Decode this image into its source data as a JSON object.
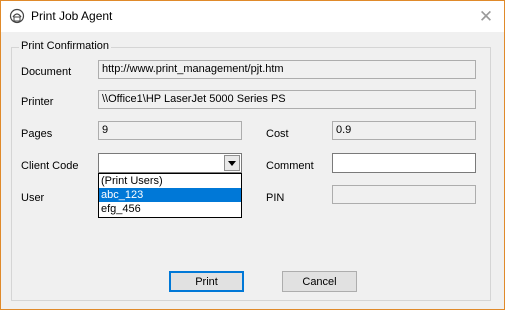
{
  "window": {
    "title": "Print Job Agent",
    "close_icon": "close-icon",
    "app_icon": "printer-agent-icon"
  },
  "group": {
    "legend": "Print Confirmation"
  },
  "labels": {
    "document": "Document",
    "printer": "Printer",
    "pages": "Pages",
    "cost": "Cost",
    "client_code": "Client Code",
    "comment": "Comment",
    "user": "User",
    "pin": "PIN"
  },
  "values": {
    "document": "http://www.print_management/pjt.htm",
    "printer": "\\\\Office1\\HP LaserJet 5000 Series PS",
    "pages": "9",
    "cost": "0.9",
    "client_code": "",
    "comment": "",
    "pin": ""
  },
  "client_code_options": [
    "(Print Users)",
    "abc_123",
    "efg_456"
  ],
  "client_code_highlighted": "abc_123",
  "buttons": {
    "print": "Print",
    "cancel": "Cancel"
  },
  "colors": {
    "accent": "#0078d7",
    "window_border": "#e08a2a"
  }
}
